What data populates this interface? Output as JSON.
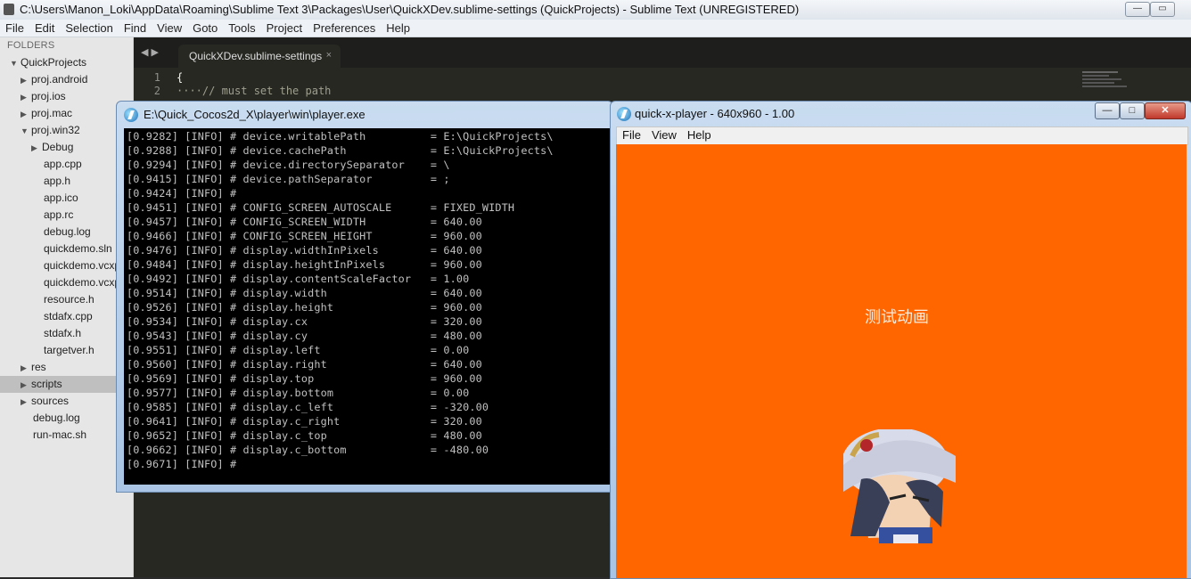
{
  "sublime": {
    "window_title": "C:\\Users\\Manon_Loki\\AppData\\Roaming\\Sublime Text 3\\Packages\\User\\QuickXDev.sublime-settings (QuickProjects) - Sublime Text (UNREGISTERED)",
    "menu": [
      "File",
      "Edit",
      "Selection",
      "Find",
      "View",
      "Goto",
      "Tools",
      "Project",
      "Preferences",
      "Help"
    ],
    "sidebar": {
      "header": "FOLDERS",
      "items": [
        {
          "label": "QuickProjects",
          "type": "folder-open"
        },
        {
          "label": "proj.android",
          "type": "folder"
        },
        {
          "label": "proj.ios",
          "type": "folder"
        },
        {
          "label": "proj.mac",
          "type": "folder"
        },
        {
          "label": "proj.win32",
          "type": "folder-open"
        },
        {
          "label": "Debug",
          "type": "folder"
        },
        {
          "label": "app.cpp",
          "type": "file"
        },
        {
          "label": "app.h",
          "type": "file"
        },
        {
          "label": "app.ico",
          "type": "file"
        },
        {
          "label": "app.rc",
          "type": "file"
        },
        {
          "label": "debug.log",
          "type": "file"
        },
        {
          "label": "quickdemo.sln",
          "type": "file"
        },
        {
          "label": "quickdemo.vcxp",
          "type": "file"
        },
        {
          "label": "quickdemo.vcxp",
          "type": "file"
        },
        {
          "label": "resource.h",
          "type": "file"
        },
        {
          "label": "stdafx.cpp",
          "type": "file"
        },
        {
          "label": "stdafx.h",
          "type": "file"
        },
        {
          "label": "targetver.h",
          "type": "file"
        },
        {
          "label": "res",
          "type": "folder"
        },
        {
          "label": "scripts",
          "type": "folder",
          "selected": true
        },
        {
          "label": "sources",
          "type": "folder"
        },
        {
          "label": "debug.log",
          "type": "file"
        },
        {
          "label": "run-mac.sh",
          "type": "file"
        }
      ]
    },
    "tab": {
      "label": "QuickXDev.sublime-settings",
      "close": "×"
    },
    "tab_nav": "◀ ▶",
    "code": [
      {
        "num": "1",
        "text": "{"
      },
      {
        "num": "2",
        "text": "····// must set the path"
      }
    ]
  },
  "console": {
    "title": "E:\\Quick_Cocos2d_X\\player\\win\\player.exe",
    "lines": [
      "[0.9282] [INFO] # device.writablePath          = E:\\QuickProjects\\",
      "[0.9288] [INFO] # device.cachePath             = E:\\QuickProjects\\",
      "[0.9294] [INFO] # device.directorySeparator    = \\",
      "[0.9415] [INFO] # device.pathSeparator         = ;",
      "[0.9424] [INFO] #",
      "[0.9451] [INFO] # CONFIG_SCREEN_AUTOSCALE      = FIXED_WIDTH",
      "[0.9457] [INFO] # CONFIG_SCREEN_WIDTH          = 640.00",
      "[0.9466] [INFO] # CONFIG_SCREEN_HEIGHT         = 960.00",
      "[0.9476] [INFO] # display.widthInPixels        = 640.00",
      "[0.9484] [INFO] # display.heightInPixels       = 960.00",
      "[0.9492] [INFO] # display.contentScaleFactor   = 1.00",
      "[0.9514] [INFO] # display.width                = 640.00",
      "[0.9526] [INFO] # display.height               = 960.00",
      "[0.9534] [INFO] # display.cx                   = 320.00",
      "[0.9543] [INFO] # display.cy                   = 480.00",
      "[0.9551] [INFO] # display.left                 = 0.00",
      "[0.9560] [INFO] # display.right                = 640.00",
      "[0.9569] [INFO] # display.top                  = 960.00",
      "[0.9577] [INFO] # display.bottom               = 0.00",
      "[0.9585] [INFO] # display.c_left               = -320.00",
      "[0.9641] [INFO] # display.c_right              = 320.00",
      "[0.9652] [INFO] # display.c_top                = 480.00",
      "[0.9662] [INFO] # display.c_bottom             = -480.00",
      "[0.9671] [INFO] #"
    ]
  },
  "player": {
    "title": "quick-x-player - 640x960 - 1.00",
    "menu": [
      "File",
      "View",
      "Help"
    ],
    "canvas_color": "#ff6600",
    "caption": "测试动画",
    "buttons": {
      "minimize": "—",
      "maximize": "□",
      "close": "✕"
    }
  }
}
